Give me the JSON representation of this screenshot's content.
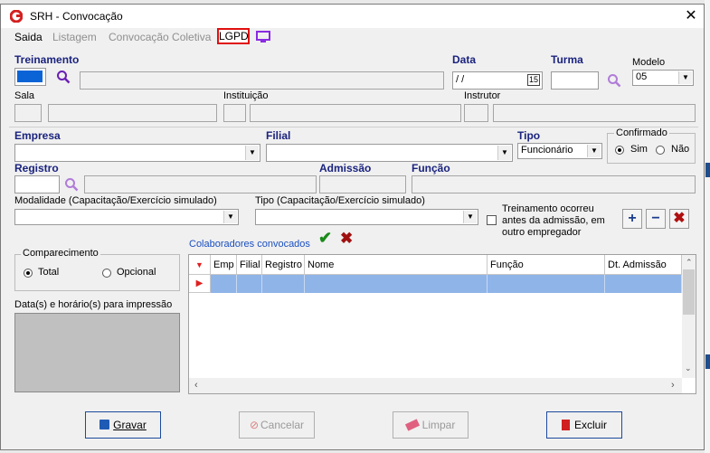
{
  "window": {
    "title": "SRH - Convocação"
  },
  "menu": {
    "saida": "Saida",
    "listagem": "Listagem",
    "convocacao_coletiva": "Convocação Coletiva",
    "lgpd": "LGPD"
  },
  "treinamento": {
    "label": "Treinamento"
  },
  "data": {
    "label": "Data",
    "value": " / /"
  },
  "turma": {
    "label": "Turma"
  },
  "modelo": {
    "label": "Modelo",
    "value": "05"
  },
  "sala": {
    "label": "Sala"
  },
  "instituicao": {
    "label": "Instituição"
  },
  "instrutor": {
    "label": "Instrutor"
  },
  "empresa": {
    "label": "Empresa"
  },
  "filial": {
    "label": "Filial"
  },
  "tipo": {
    "label": "Tipo",
    "value": "Funcionário"
  },
  "confirmado": {
    "label": "Confirmado",
    "sim": "Sim",
    "nao": "Não"
  },
  "registro": {
    "label": "Registro"
  },
  "admissao": {
    "label": "Admissão"
  },
  "funcao": {
    "label": "Função"
  },
  "modalidade": {
    "label": "Modalidade (Capacitação/Exercício simulado)"
  },
  "tipo_cap": {
    "label": "Tipo (Capacitação/Exercício simulado)"
  },
  "treinamento_antes": {
    "line1": "Treinamento ocorreu",
    "line2": "antes da admissão, em",
    "line3": "outro empregador"
  },
  "comparecimento": {
    "label": "Comparecimento",
    "total": "Total",
    "opcional": "Opcional"
  },
  "datas_label": "Data(s) e horário(s) para impressão",
  "colaboradores": {
    "label": "Colaboradores convocados",
    "columns": [
      "Emp",
      "Filial",
      "Registro",
      "Nome",
      "Função",
      "Dt. Admissão"
    ]
  },
  "buttons": {
    "gravar": "Gravar",
    "cancelar": "Cancelar",
    "limpar": "Limpar",
    "excluir": "Excluir"
  },
  "colors": {
    "accent_label": "#1a237e",
    "selected_row": "#8fb4e8",
    "highlight": "#e01010",
    "purple_icon": "#8a2be2"
  }
}
